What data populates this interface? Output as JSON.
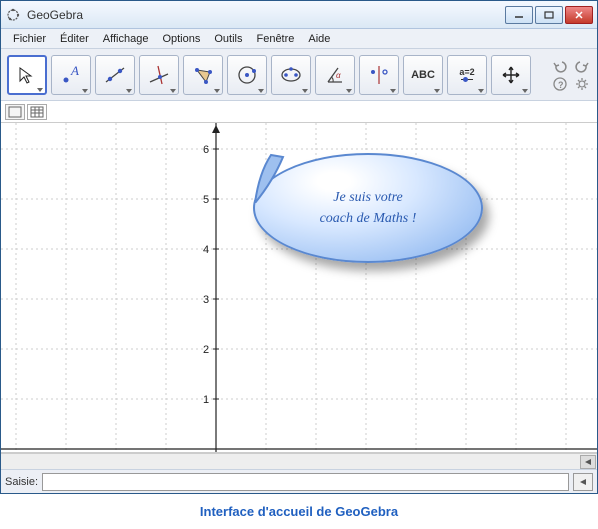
{
  "title": "GeoGebra",
  "menu": [
    "Fichier",
    "Éditer",
    "Affichage",
    "Options",
    "Outils",
    "Fenêtre",
    "Aide"
  ],
  "tools": {
    "text_btn": "ABC",
    "var_btn": "a=2"
  },
  "axis": {
    "y_ticks": [
      "6",
      "5",
      "4",
      "3",
      "2",
      "1"
    ]
  },
  "bubble": {
    "line1": "Je  suis votre",
    "line2": "coach de Maths !"
  },
  "input": {
    "label": "Saisie:",
    "value": ""
  },
  "caption": "Interface d'accueil de GeoGebra"
}
